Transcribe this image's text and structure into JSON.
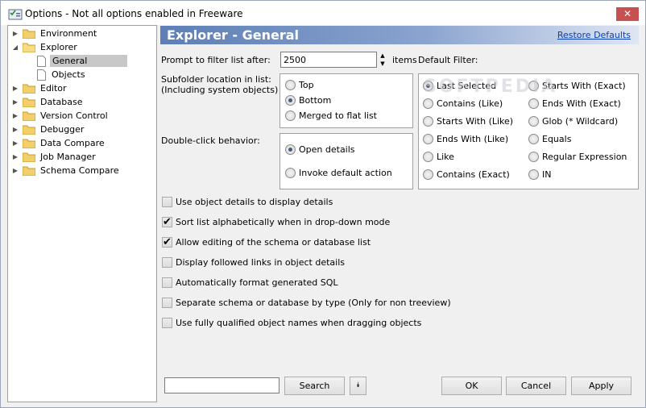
{
  "window": {
    "title": "Options - Not all options enabled in Freeware",
    "close_label": "✕"
  },
  "tree": {
    "items": [
      {
        "label": "Environment"
      },
      {
        "label": "Explorer"
      },
      {
        "label": "General"
      },
      {
        "label": "Objects"
      },
      {
        "label": "Editor"
      },
      {
        "label": "Database"
      },
      {
        "label": "Version Control"
      },
      {
        "label": "Debugger"
      },
      {
        "label": "Data Compare"
      },
      {
        "label": "Job Manager"
      },
      {
        "label": "Schema Compare"
      }
    ]
  },
  "header": {
    "title": "Explorer - General",
    "restore_label": "Restore Defaults"
  },
  "prompt": {
    "label": "Prompt to filter list after:",
    "value": "2500",
    "unit": "items"
  },
  "subfolder": {
    "label_line1": "Subfolder location in list:",
    "label_line2": "(Including system objects)",
    "options": [
      "Top",
      "Bottom",
      "Merged to flat list"
    ],
    "selected": "Bottom"
  },
  "doubleclick": {
    "label": "Double-click behavior:",
    "options": [
      "Open details",
      "Invoke default action"
    ],
    "selected": "Open details"
  },
  "default_filter": {
    "label": "Default Filter:",
    "left": [
      "Last Selected",
      "Contains (Like)",
      "Starts With (Like)",
      "Ends With (Like)",
      "Like",
      "Contains (Exact)"
    ],
    "right": [
      "Starts With (Exact)",
      "Ends With (Exact)",
      "Glob (* Wildcard)",
      "Equals",
      "Regular Expression",
      "IN"
    ],
    "selected": "Last Selected"
  },
  "checkboxes": [
    {
      "label": "Use object details to display details",
      "checked": false
    },
    {
      "label": "Sort list alphabetically when in drop-down mode",
      "checked": true
    },
    {
      "label": "Allow editing of the schema or database list",
      "checked": true
    },
    {
      "label": "Display followed links in object details",
      "checked": false
    },
    {
      "label": "Automatically format generated SQL",
      "checked": false
    },
    {
      "label": "Separate schema or database by type (Only for non treeview)",
      "checked": false
    },
    {
      "label": "Use fully qualified object names when dragging objects",
      "checked": false
    }
  ],
  "footer": {
    "search_value": "",
    "search_label": "Search",
    "ok_label": "OK",
    "cancel_label": "Cancel",
    "apply_label": "Apply"
  },
  "watermark": "SOFTPEDIA"
}
